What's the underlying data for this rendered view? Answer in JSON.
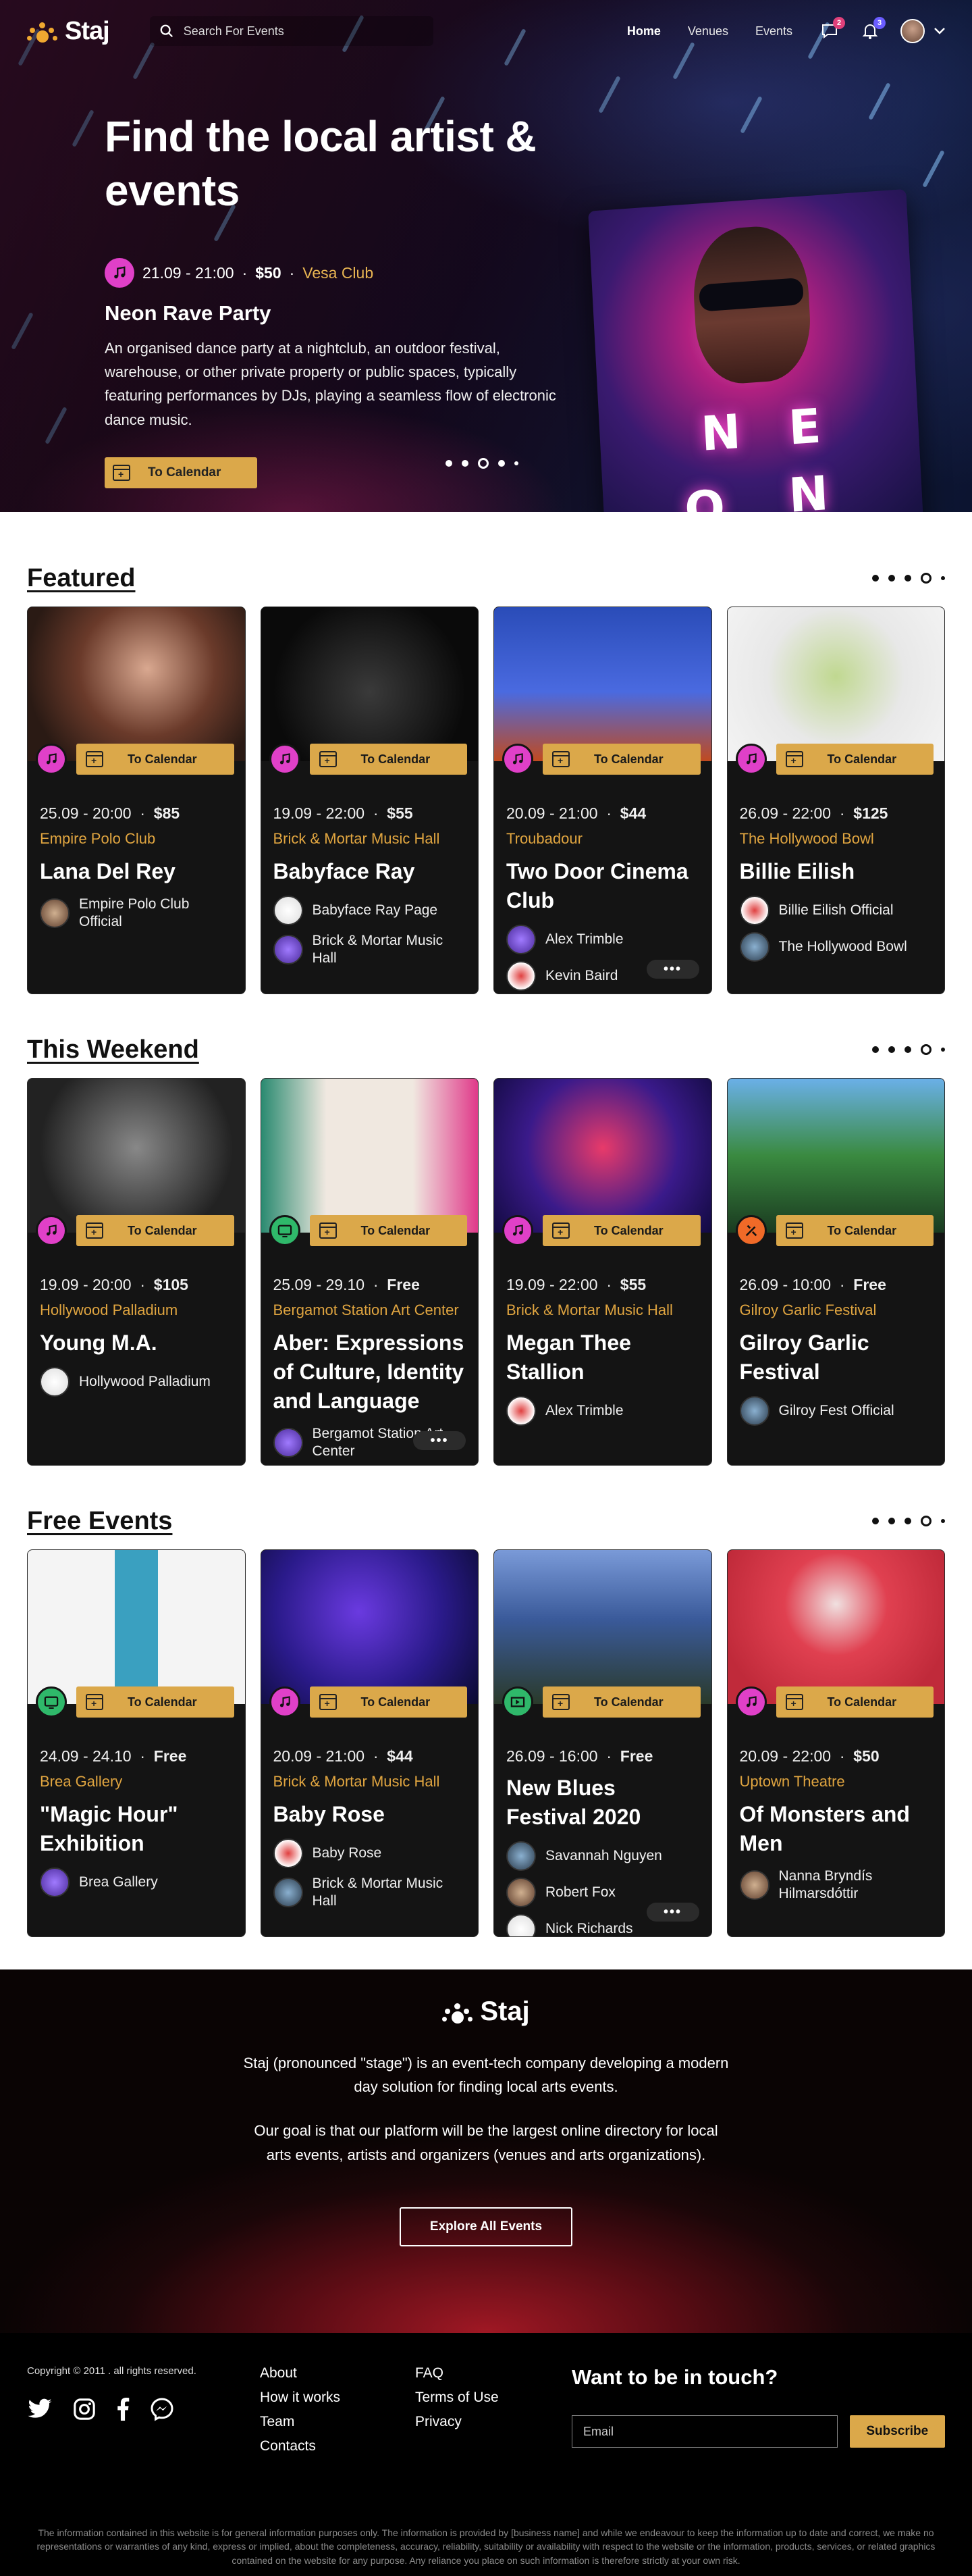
{
  "nav": {
    "brand": "Staj",
    "search_placeholder": "Search For Events",
    "links": [
      "Home",
      "Venues",
      "Events"
    ],
    "chat_badge": "2",
    "bell_badge": "3"
  },
  "hero": {
    "title": "Find the local artist & events",
    "date": "21.09 - 21:00",
    "price": "$50",
    "venue": "Vesa Club",
    "event": "Neon Rave Party",
    "description": "An organised dance party at a nightclub, an outdoor festival, warehouse, or other private property or public spaces, typically featuring performances by DJs, playing a seamless flow of electronic dance music.",
    "calendar_label": "To Calendar",
    "poster_letters": [
      "N",
      "E",
      "O",
      "N"
    ]
  },
  "sections": [
    {
      "title": "Featured",
      "cards": [
        {
          "date": "25.09 - 20:00",
          "price": "$85",
          "venue": "Empire Polo Club",
          "title": "Lana Del Rey",
          "category": "music",
          "people": [
            "Empire Polo Club Official"
          ],
          "more": false
        },
        {
          "date": "19.09 - 22:00",
          "price": "$55",
          "venue": "Brick & Mortar Music Hall",
          "title": "Babyface Ray",
          "category": "music",
          "people": [
            "Babyface Ray Page",
            "Brick & Mortar Music Hall"
          ],
          "more": false
        },
        {
          "date": "20.09 - 21:00",
          "price": "$44",
          "venue": "Troubadour",
          "title": "Two Door Cinema Club",
          "category": "music",
          "people": [
            "Alex Trimble",
            "Kevin Baird"
          ],
          "more": true
        },
        {
          "date": "26.09 - 22:00",
          "price": "$125",
          "venue": "The Hollywood Bowl",
          "title": "Billie Eilish",
          "category": "music",
          "people": [
            "Billie Eilish Official",
            "The Hollywood Bowl"
          ],
          "more": false
        }
      ]
    },
    {
      "title": "This Weekend",
      "cards": [
        {
          "date": "19.09 - 20:00",
          "price": "$105",
          "venue": "Hollywood Palladium",
          "title": "Young M.A.",
          "category": "music",
          "people": [
            "Hollywood Palladium"
          ],
          "more": false
        },
        {
          "date": "25.09 - 29.10",
          "price": "Free",
          "venue": "Bergamot Station Art Center",
          "title": "Aber: Expressions of Culture, Identity and Language",
          "category": "art",
          "people": [
            "Bergamot Station Art Center"
          ],
          "more": true
        },
        {
          "date": "19.09 - 22:00",
          "price": "$55",
          "venue": "Brick & Mortar Music Hall",
          "title": "Megan Thee Stallion",
          "category": "music",
          "people": [
            "Alex Trimble"
          ],
          "more": false
        },
        {
          "date": "26.09 - 10:00",
          "price": "Free",
          "venue": "Gilroy Garlic Festival",
          "title": "Gilroy Garlic Festival",
          "category": "food",
          "people": [
            "Gilroy Fest Official"
          ],
          "more": false
        }
      ]
    },
    {
      "title": "Free Events",
      "cards": [
        {
          "date": "24.09 - 24.10",
          "price": "Free",
          "venue": "Brea Gallery",
          "title": "\"Magic Hour\" Exhibition",
          "category": "art",
          "people": [
            "Brea Gallery"
          ],
          "more": false
        },
        {
          "date": "20.09 - 21:00",
          "price": "$44",
          "venue": "Brick & Mortar Music Hall",
          "title": "Baby Rose",
          "category": "music",
          "people": [
            "Baby Rose",
            "Brick & Mortar Music Hall"
          ],
          "more": false
        },
        {
          "date": "26.09 - 16:00",
          "price": "Free",
          "venue": "",
          "title": "New Blues Festival 2020",
          "category": "film",
          "people": [
            "Savannah Nguyen",
            "Robert Fox",
            "Nick Richards"
          ],
          "more": true
        },
        {
          "date": "20.09 - 22:00",
          "price": "$50",
          "venue": "Uptown Theatre",
          "title": "Of Monsters and Men",
          "category": "music",
          "people": [
            "Nanna Bryndís Hilmarsdóttir"
          ],
          "more": false
        }
      ]
    }
  ],
  "calendar_label": "To Calendar",
  "footer": {
    "brand": "Staj",
    "text1": "Staj (pronounced \"stage\") is an event-tech company developing a modern day solution for finding local arts events.",
    "text2": "Our goal is that our platform will be the largest online directory for local arts events, artists and organizers (venues and arts organizations).",
    "explore_label": "Explore All Events",
    "copyright": "Copyright © 2011 . all rights reserved.",
    "links1": [
      "About",
      "How it works",
      "Team",
      "Contacts"
    ],
    "links2": [
      "FAQ",
      "Terms of Use",
      "Privacy"
    ],
    "touch_title": "Want to be in touch?",
    "email_placeholder": "Email",
    "subscribe_label": "Subscribe",
    "disclaimer": "The information contained in this website is for general information purposes only. The information is provided by [business name] and while we endeavour to keep the information up to date and correct, we make no representations or warranties of any kind, express or implied, about the completeness, accuracy, reliability, suitability or availability with respect to the website or the information, products, services, or related graphics contained on the website for any purpose. Any reliance you place on such information is therefore strictly at your own risk."
  },
  "colors": {
    "accent": "#dba84a",
    "venue": "#e0a540",
    "music": "#e040c8",
    "art": "#2fb86a",
    "food": "#f06a28",
    "film": "#2fb86a"
  }
}
